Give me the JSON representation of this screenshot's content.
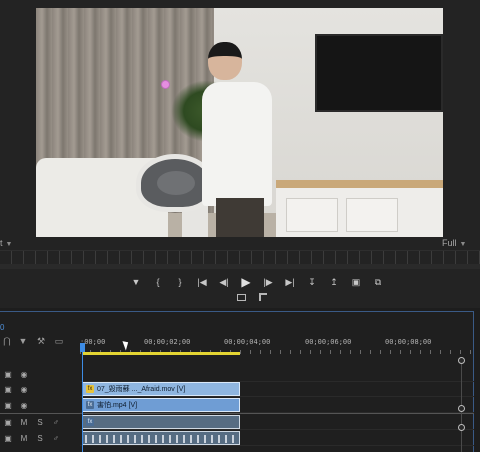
{
  "monitor": {
    "fit_left": "t",
    "fit_right": "Full",
    "transport": [
      {
        "name": "add-marker-icon",
        "glyph": "▼"
      },
      {
        "name": "mark-in-icon",
        "glyph": "{"
      },
      {
        "name": "mark-out-icon",
        "glyph": "}"
      },
      {
        "name": "go-to-in-icon",
        "glyph": "|◀"
      },
      {
        "name": "step-back-icon",
        "glyph": "◀|"
      },
      {
        "name": "play-icon",
        "glyph": "▶"
      },
      {
        "name": "step-forward-icon",
        "glyph": "|▶"
      },
      {
        "name": "go-to-out-icon",
        "glyph": "▶|"
      },
      {
        "name": "lift-icon",
        "glyph": "↧"
      },
      {
        "name": "extract-icon",
        "glyph": "↥"
      },
      {
        "name": "export-frame-icon",
        "glyph": "▣"
      },
      {
        "name": "comparison-view-icon",
        "glyph": "⧉"
      }
    ]
  },
  "timeline": {
    "current_time": "0",
    "ruler": [
      ";00;00",
      "00;00;02;00",
      "00;00;04;00",
      "00;00;06;00",
      "00;00;08;00"
    ],
    "tools": [
      {
        "name": "snap-icon",
        "glyph": "⋂"
      },
      {
        "name": "add-marker-tl-icon",
        "glyph": "▼"
      },
      {
        "name": "wrench-icon",
        "glyph": "⚒"
      },
      {
        "name": "captions-icon",
        "glyph": "▭"
      }
    ],
    "tracks": [
      {
        "kind": "video",
        "toggle": "▣",
        "eye": "◉"
      },
      {
        "kind": "video",
        "toggle": "▣",
        "eye": "◉"
      },
      {
        "kind": "video",
        "toggle": "▣",
        "eye": "◉"
      },
      {
        "kind": "audio",
        "toggle": "▣",
        "mute": "M",
        "solo": "S",
        "mic": "♂"
      },
      {
        "kind": "audio",
        "toggle": "▣",
        "mute": "M",
        "solo": "S",
        "mic": "♂"
      }
    ],
    "clips": {
      "v2_label": "07_毀雨蘇 ..._Afraid.mov [V]",
      "v1_label": "害怕.mp4 [V]",
      "fx_badge": "fx"
    }
  }
}
